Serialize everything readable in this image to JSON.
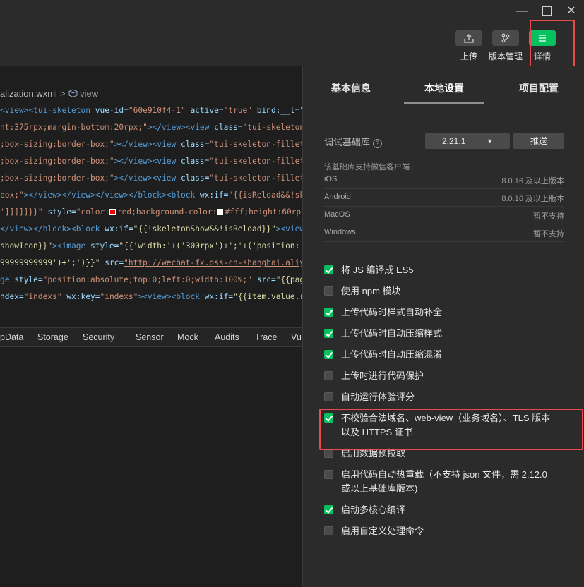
{
  "window": {
    "minimize": "—",
    "close": "✕"
  },
  "toolbar": {
    "upload_label": "上传",
    "version_label": "版本管理",
    "detail_label": "详情",
    "upload_icon": "upload-icon",
    "version_icon": "branch-icon",
    "detail_icon": "menu-icon"
  },
  "editor": {
    "breadcrumb_file": "alization.wxml",
    "breadcrumb_sep": ">",
    "breadcrumb_node": "view"
  },
  "code_lines": {
    "l1a": "<view>",
    "l1b": "<tui-skeleton",
    "l1c": " vue-id=",
    "l1d": "\"60e910f4-1\"",
    "l1e": " active=",
    "l1f": "\"true\"",
    "l1g": " bind:__l=\"",
    "l2a": "nt:375rpx;margin-bottom:20rpx;\"",
    "l2b": "></view>",
    "l2c": "<view",
    "l2d": " class=",
    "l2e": "\"tui-skeleton-",
    "l3a": ";box-sizing:border-box;\"",
    "l3b": "></view>",
    "l3c": "<view",
    "l3d": " class=",
    "l3e": "\"tui-skeleton-fillet\"",
    "l4a": ";box-sizing:border-box;\"",
    "l4b": "></view>",
    "l4c": "<view",
    "l4d": " class=",
    "l4e": "\"tui-skeleton-fillet\"",
    "l5a": ";box-sizing:border-box;\"",
    "l5b": "></view>",
    "l5c": "<view",
    "l5d": " class=",
    "l5e": "\"tui-skeleton-fillet\"",
    "l6a": "box;\"",
    "l6b": "></view></view></view></block>",
    "l6c": "<block",
    "l6d": " wx:if=",
    "l6e": "\"{{isReload&&!skel",
    "l7a": "']]]]]}}\"",
    "l7b": " style=",
    "l7c": "\"color:",
    "l7d": "red;background-color:",
    "l7e": "#fff;height:60rp",
    "l8a": "</view></block>",
    "l8b": "<block",
    "l8c": " wx:if=",
    "l8d": "\"{{!skeletonShow&&!isReload}}\"",
    "l8e": "><view",
    "l9a": "showIcon}}\"",
    "l9b": "><image",
    "l9c": " style=",
    "l9d": "\"{{'width:'+('300rpx')+';'+('position:'-",
    "l10a": "99999999999')+';')}}\"",
    "l10b": " src=",
    "l10c": "\"http://wechat-fx.oss-cn-shanghai.aliyu",
    "l11a": "ge",
    "l11b": " style=",
    "l11c": "\"position:absolute;top:0;left:0;width:100%;\"",
    "l11d": " src=",
    "l11e": "\"{{pageU",
    "l12a": "ndex=",
    "l12b": "\"indexs\"",
    "l12c": " wx:key=",
    "l12d": "\"indexs\"",
    "l12e": "><view><block",
    "l12f": " wx:if=",
    "l12g": "\"{{item.value.re"
  },
  "devtools_tabs": [
    "pData",
    "Storage",
    "Security",
    "Sensor",
    "Mock",
    "Audits",
    "Trace",
    "Vu"
  ],
  "panel": {
    "tabs": [
      "基本信息",
      "本地设置",
      "项目配置"
    ],
    "lib_label": "调试基础库",
    "lib_help": "?",
    "lib_version": "2.21.1",
    "lib_caret": "▼",
    "push_label": "推送",
    "support_note": "该基础库支持微信客户端",
    "env": [
      {
        "k": "iOS",
        "v": "8.0.16 及以上版本"
      },
      {
        "k": "Android",
        "v": "8.0.16 及以上版本"
      },
      {
        "k": "MacOS",
        "v": "暂不支持"
      },
      {
        "k": "Windows",
        "v": "暂不支持"
      }
    ],
    "options": [
      {
        "label": "将 JS 编译成 ES5",
        "checked": true
      },
      {
        "label": "使用 npm 模块",
        "checked": false
      },
      {
        "label": "上传代码时样式自动补全",
        "checked": true
      },
      {
        "label": "上传代码时自动压缩样式",
        "checked": true
      },
      {
        "label": "上传代码时自动压缩混淆",
        "checked": true
      },
      {
        "label": "上传时进行代码保护",
        "checked": false
      },
      {
        "label": "自动运行体验评分",
        "checked": false
      },
      {
        "label": "不校验合法域名、web-view（业务域名）、TLS 版本以及 HTTPS 证书",
        "checked": true
      },
      {
        "label": "启用数据预拉取",
        "checked": false
      },
      {
        "label": "启用代码自动热重载（不支持 json 文件，需 2.12.0 或以上基础库版本)",
        "checked": false
      },
      {
        "label": "启动多核心编译",
        "checked": true
      },
      {
        "label": "启用自定义处理命令",
        "checked": false
      }
    ]
  },
  "colors": {
    "accent": "#07c160",
    "highlight": "#e84b4b"
  }
}
